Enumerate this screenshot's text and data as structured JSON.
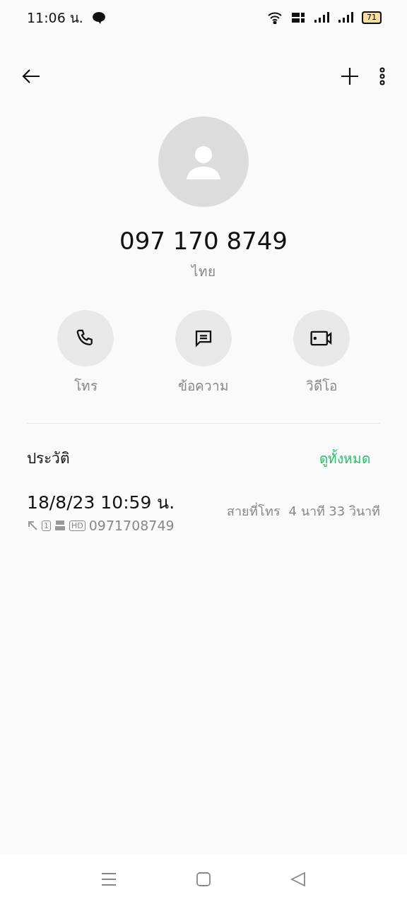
{
  "status_bar": {
    "time": "11:06 น.",
    "battery": "71"
  },
  "contact": {
    "number": "097 170 8749",
    "location": "ไทย"
  },
  "actions": [
    {
      "kind": "call",
      "label": "โทร"
    },
    {
      "kind": "message",
      "label": "ข้อความ"
    },
    {
      "kind": "video",
      "label": "วิดีโอ"
    }
  ],
  "history": {
    "title": "ประวัติ",
    "see_all": "ดูทั้งหมด",
    "entries": [
      {
        "datetime": "18/8/23 10:59 น.",
        "sim": "1",
        "hd": "HD",
        "number": "0971708749",
        "duration_label": "สายที่โทร",
        "duration": "4 นาที 33 วินาที"
      }
    ]
  }
}
